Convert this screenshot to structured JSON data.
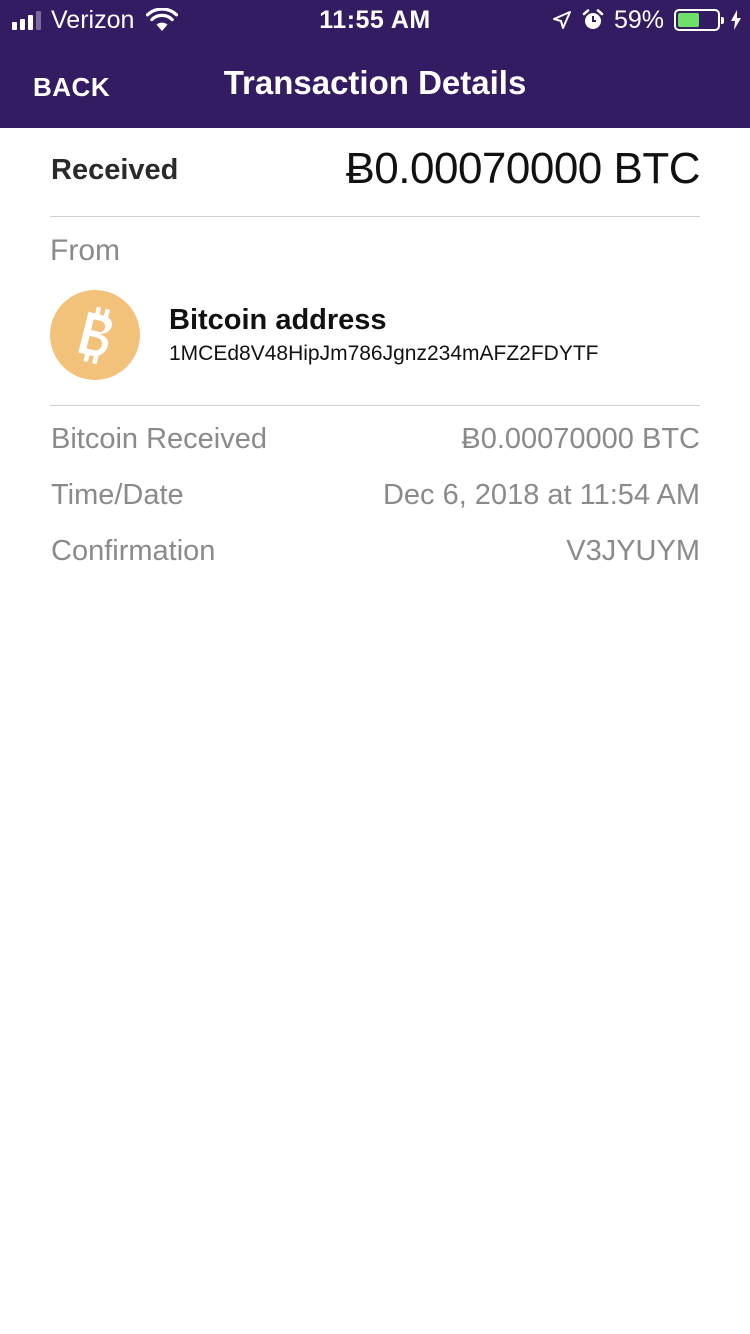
{
  "status_bar": {
    "carrier": "Verizon",
    "time": "11:55 AM",
    "battery_percent": "59%",
    "battery_level": 0.59,
    "icons": [
      "signal-icon",
      "wifi-icon",
      "location-arrow-icon",
      "alarm-icon",
      "battery-icon",
      "charging-bolt-icon"
    ]
  },
  "nav": {
    "back_label": "BACK",
    "title": "Transaction Details"
  },
  "summary": {
    "label": "Received",
    "amount": "Ƀ0.00070000 BTC"
  },
  "from": {
    "label": "From",
    "icon": "bitcoin-icon",
    "title": "Bitcoin address",
    "address": "1MCEd8V48HipJm786Jgnz234mAFZ2FDYTF"
  },
  "details": [
    {
      "label": "Bitcoin Received",
      "value": "Ƀ0.00070000 BTC"
    },
    {
      "label": "Time/Date",
      "value": "Dec 6, 2018 at 11:54 AM"
    },
    {
      "label": "Confirmation",
      "value": "V3JYUYM"
    }
  ],
  "colors": {
    "header_bg": "#341c62",
    "bitcoin_icon_bg": "#f2c27b",
    "battery_fill": "#6ee06a",
    "secondary_text": "#8a8a8a"
  }
}
